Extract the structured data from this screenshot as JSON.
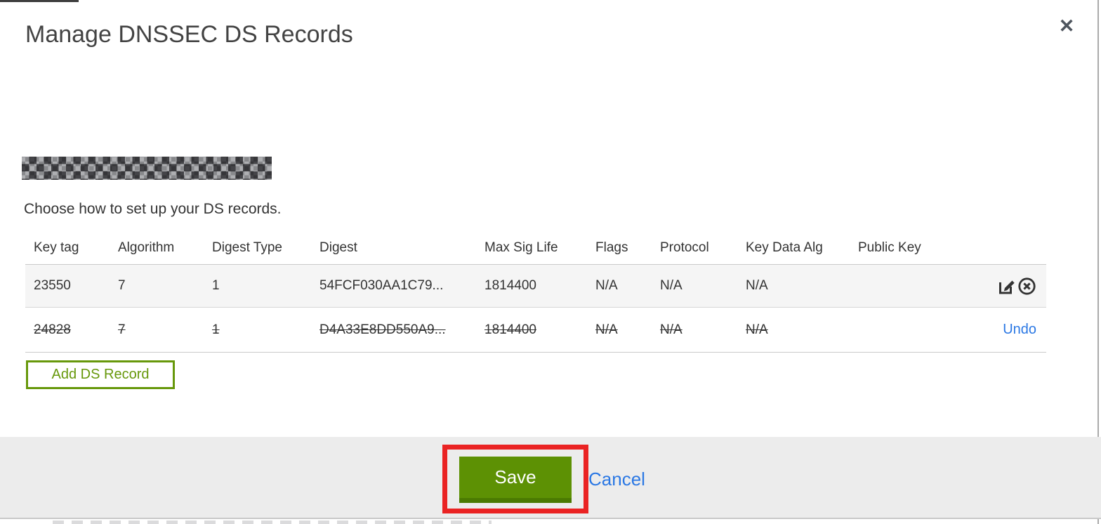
{
  "dialog": {
    "title": "Manage DNSSEC DS Records",
    "close_label": "✕",
    "subtitle": "Choose how to set up your DS records.",
    "domain": {
      "redacted": true
    },
    "table": {
      "columns": [
        "Key tag",
        "Algorithm",
        "Digest Type",
        "Digest",
        "Max Sig Life",
        "Flags",
        "Protocol",
        "Key Data Alg",
        "Public Key"
      ],
      "field_order": [
        "key_tag",
        "algorithm",
        "digest_type",
        "digest",
        "max_sig_life",
        "flags",
        "protocol",
        "key_data_alg",
        "public_key"
      ],
      "rows": [
        {
          "key_tag": "23550",
          "algorithm": "7",
          "digest_type": "1",
          "digest": "54FCF030AA1C79...",
          "max_sig_life": "1814400",
          "flags": "N/A",
          "protocol": "N/A",
          "key_data_alg": "N/A",
          "public_key": "",
          "state": "normal",
          "actions": [
            "edit",
            "remove"
          ]
        },
        {
          "key_tag": "24828",
          "algorithm": "7",
          "digest_type": "1",
          "digest": "D4A33E8DD550A9...",
          "max_sig_life": "1814400",
          "flags": "N/A",
          "protocol": "N/A",
          "key_data_alg": "N/A",
          "public_key": "",
          "state": "deleted",
          "undo_label": "Undo"
        }
      ]
    },
    "add_button_label": "Add DS Record",
    "footer": {
      "save_label": "Save",
      "cancel_label": "Cancel"
    }
  },
  "icons": {
    "edit": "edit-icon",
    "remove": "remove-circle-icon"
  },
  "colors": {
    "button_green": "#5d9104",
    "button_green_dark": "#4b7a02",
    "outline_green": "#67980b",
    "link_blue": "#2b78e4",
    "annotation_red": "#ea2323",
    "row_stripe": "#f5f5f5",
    "footer_gray": "#ececec"
  }
}
